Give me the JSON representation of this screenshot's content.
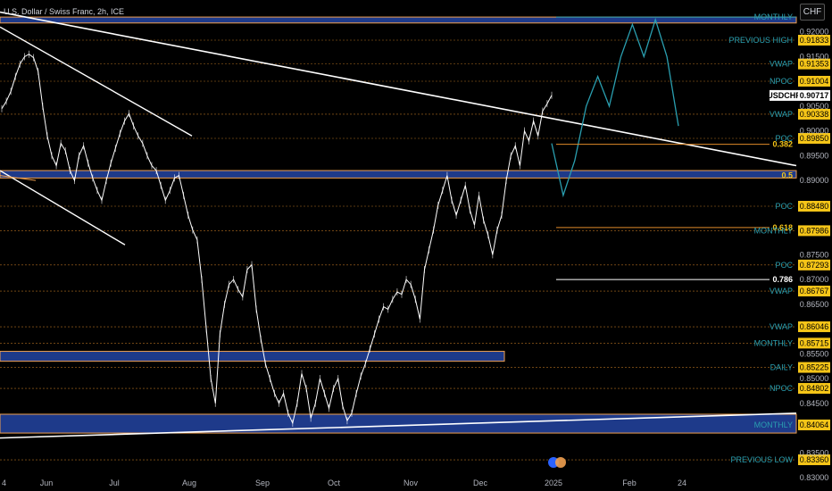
{
  "header": {
    "symbol_title": "U.S. Dollar / Swiss Franc, 2h, ICE",
    "currency_badge": "CHF"
  },
  "colors": {
    "background": "#000000",
    "price_line": "#ffffff",
    "zone_fill": "#1e3a8a",
    "zone_border": "#f0a050",
    "level_dash": "#e08a2a",
    "cyan": "#2a9fb0",
    "label_yellow": "#f5c518",
    "label_white": "#ffffff",
    "trendline": "#ffffff"
  },
  "chart_data": {
    "type": "line",
    "title": "U.S. Dollar / Swiss Franc, 2h, ICE",
    "symbol": "USDCHF",
    "last_price": 0.90717,
    "ylim": [
      0.83,
      0.925
    ],
    "y_ticks": [
      "0.92000",
      "0.91500",
      "0.90500",
      "0.90000",
      "0.89500",
      "0.89000",
      "0.87500",
      "0.87000",
      "0.86500",
      "0.85500",
      "0.85000",
      "0.84500",
      "0.83500",
      "0.83000"
    ],
    "x_ticks": [
      "4",
      "Jun",
      "Jul",
      "Aug",
      "Sep",
      "Oct",
      "Nov",
      "Dec",
      "2025",
      "Feb",
      "24"
    ],
    "series": [
      {
        "values": [
          0.9045,
          0.906,
          0.908,
          0.911,
          0.9135,
          0.915,
          0.9155,
          0.9148,
          0.912,
          0.905,
          0.899,
          0.895,
          0.893,
          0.8975,
          0.896,
          0.892,
          0.89,
          0.895,
          0.897,
          0.8935,
          0.8905,
          0.888,
          0.886,
          0.89,
          0.8935,
          0.8965,
          0.8995,
          0.902,
          0.9035,
          0.901,
          0.899,
          0.8975,
          0.895,
          0.893,
          0.892,
          0.889,
          0.886,
          0.888,
          0.8905,
          0.891,
          0.887,
          0.883,
          0.88,
          0.878,
          0.87,
          0.86,
          0.85,
          0.845,
          0.859,
          0.865,
          0.869,
          0.87,
          0.868,
          0.8665,
          0.872,
          0.873,
          0.864,
          0.858,
          0.853,
          0.85,
          0.847,
          0.845,
          0.847,
          0.843,
          0.841,
          0.845,
          0.851,
          0.848,
          0.842,
          0.845,
          0.85,
          0.847,
          0.844,
          0.848,
          0.85,
          0.8445,
          0.8415,
          0.843,
          0.847,
          0.8505,
          0.853,
          0.856,
          0.859,
          0.862,
          0.8645,
          0.864,
          0.866,
          0.8675,
          0.867,
          0.87,
          0.869,
          0.866,
          0.862,
          0.872,
          0.876,
          0.88,
          0.885,
          0.888,
          0.891,
          0.886,
          0.883,
          0.886,
          0.889,
          0.884,
          0.881,
          0.887,
          0.882,
          0.879,
          0.875,
          0.88,
          0.883,
          0.89,
          0.895,
          0.897,
          0.893,
          0.9,
          0.898,
          0.902,
          0.899,
          0.904,
          0.9055,
          0.9072
        ]
      }
    ],
    "projection_path": [
      0.8975,
      0.887,
      0.894,
      0.905,
      0.911,
      0.905,
      0.915,
      0.9215,
      0.915,
      0.9225,
      0.915,
      0.901
    ],
    "zones": [
      {
        "top": 0.892,
        "bottom": 0.8905
      },
      {
        "top": 0.8555,
        "bottom": 0.8535
      },
      {
        "top": 0.8428,
        "bottom": 0.839
      },
      {
        "top": 0.923,
        "bottom": 0.9218
      }
    ],
    "levels": [
      {
        "price": 0.91833,
        "name": "PREVIOUS HIGH",
        "label": "0.91833",
        "style": "cyan"
      },
      {
        "price": 0.91353,
        "name": "VWAP",
        "label": "0.91353",
        "style": "cyan"
      },
      {
        "price": 0.91004,
        "name": "NPOC",
        "label": "0.91004",
        "style": "cyan"
      },
      {
        "price": 0.90338,
        "name": "VWAP",
        "label": "0.90338",
        "style": "cyan"
      },
      {
        "price": 0.8985,
        "name": "POC",
        "label": "0.89850",
        "style": "cyan"
      },
      {
        "price": 0.8848,
        "name": "POC",
        "label": "0.88480",
        "style": "cyan"
      },
      {
        "price": 0.87986,
        "name": "MONTHLY",
        "label": "0.87986",
        "style": "cyan"
      },
      {
        "price": 0.87293,
        "name": "POC",
        "label": "0.87293",
        "style": "cyan"
      },
      {
        "price": 0.86767,
        "name": "VWAP",
        "label": "0.86767",
        "style": "cyan"
      },
      {
        "price": 0.86046,
        "name": "VWAP",
        "label": "0.86046",
        "style": "cyan"
      },
      {
        "price": 0.85715,
        "name": "MONTHLY",
        "label": "0.85715",
        "style": "cyan"
      },
      {
        "price": 0.85225,
        "name": "DAILY",
        "label": "0.85225",
        "style": "cyan"
      },
      {
        "price": 0.84802,
        "name": "NPOC",
        "label": "0.84802",
        "style": "cyan"
      },
      {
        "price": 0.84064,
        "name": "MONTHLY",
        "label": "0.84064",
        "style": "cyan"
      },
      {
        "price": 0.8336,
        "name": "PREVIOUS LOW",
        "label": "0.83360",
        "style": "cyan"
      }
    ],
    "fib_levels": [
      {
        "ratio": "0.382",
        "price": 0.8973
      },
      {
        "ratio": "0.5",
        "price": 0.891
      },
      {
        "ratio": "0.618",
        "price": 0.8805
      },
      {
        "ratio": "0.786",
        "price": 0.87
      }
    ],
    "top_tag": "MONTHLY"
  }
}
